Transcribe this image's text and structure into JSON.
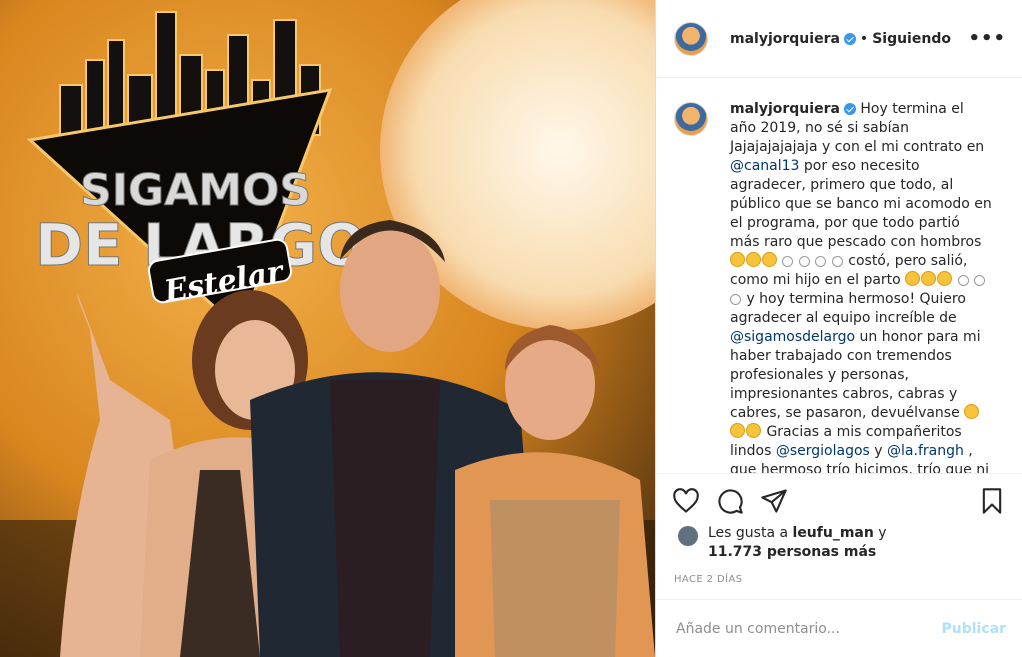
{
  "post_image": {
    "logo_line1": "SIGAMOS",
    "logo_line2": "DE LARGO",
    "logo_line3": "Estelar",
    "colors": {
      "sky": "#f0a83a",
      "moon": "#fbe9c8",
      "dark": "#1a1208"
    }
  },
  "header": {
    "username": "malyjorquiera",
    "separator": "•",
    "follow_status": "Siguiendo",
    "more_icon": "ellipsis-icon"
  },
  "caption": {
    "username": "malyjorquiera",
    "t1": "Hoy termina el año 2019, no sé si sabían Jajajajajajaja y con el mi contrato en ",
    "m1": "@canal13",
    "t2": " por eso necesito agradecer, primero que todo, al público que se banco mi acomodo en el programa, por que todo partió más raro que pescado con hombros ",
    "t3": " costó, pero salió, como mi hijo en el parto ",
    "t4": " y hoy termina hermoso! Quiero agradecer al equipo increíble de ",
    "m2": "@sigamosdelargo",
    "t5": " un honor para mi haber trabajado con tremendos profesionales y personas, impresionantes cabros, cabras y cabres, se pasaron, devuélvanse ",
    "t6": " Gracias a mis compañeritos lindos ",
    "m3": "@sergiolagos",
    "t7": " y ",
    "m4": "@la.frangh",
    "t8": " , que hermoso trío hicimos, trío que ni en"
  },
  "actions": {
    "like": "heart-icon",
    "comment": "comment-icon",
    "share": "share-icon",
    "save": "bookmark-icon"
  },
  "likes": {
    "prefix": "Les gusta a ",
    "user": "leufu_man",
    "mid": " y",
    "count": "11.773 personas más"
  },
  "timestamp": "Hace 2 días",
  "comment_box": {
    "placeholder": "Añade un comentario...",
    "publish": "Publicar"
  }
}
